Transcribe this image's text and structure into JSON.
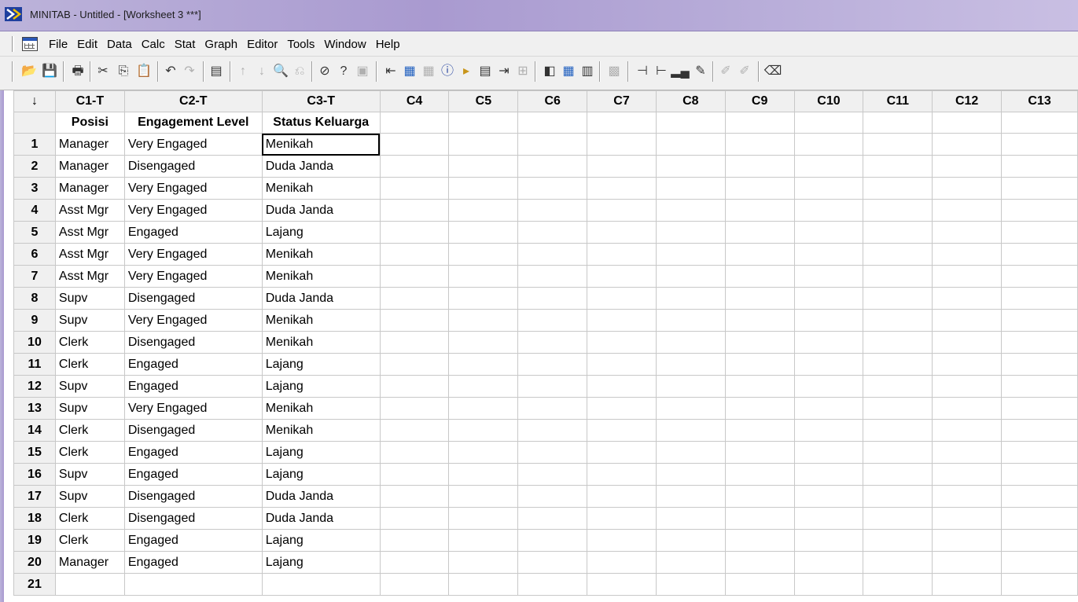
{
  "window": {
    "title": "MINITAB - Untitled - [Worksheet 3 ***]"
  },
  "menu": [
    "File",
    "Edit",
    "Data",
    "Calc",
    "Stat",
    "Graph",
    "Editor",
    "Tools",
    "Window",
    "Help"
  ],
  "toolbar": {
    "icons": [
      "open-icon",
      "save-icon",
      "print-icon",
      "cut-icon",
      "copy-icon",
      "paste-icon",
      "undo-icon",
      "redo-icon",
      "session-icon",
      "up-arrow-icon",
      "down-arrow-icon",
      "find-icon",
      "replace-icon",
      "cancel-icon",
      "help-icon",
      "project-manager-icon",
      "session-folder-icon",
      "worksheet-folder-icon",
      "graphs-folder-icon",
      "info-icon",
      "history-icon",
      "report-pad-icon",
      "related-docs-icon",
      "design-icon",
      "show-session-icon",
      "show-data-icon",
      "show-info-icon",
      "close-graphs-icon",
      "add-column-icon",
      "insert-column-icon",
      "bar-tool-icon",
      "brush-icon",
      "paint-icon",
      "eraser-icon"
    ]
  },
  "worksheet": {
    "corner": "↓",
    "columns": [
      "C1-T",
      "C2-T",
      "C3-T",
      "C4",
      "C5",
      "C6",
      "C7",
      "C8",
      "C9",
      "C10",
      "C11",
      "C12",
      "C13"
    ],
    "names": [
      "Posisi",
      "Engagement Level",
      "Status Keluarga",
      "",
      "",
      "",
      "",
      "",
      "",
      "",
      "",
      "",
      ""
    ],
    "rows": [
      [
        "Manager",
        "Very Engaged",
        "Menikah"
      ],
      [
        "Manager",
        "Disengaged",
        "Duda Janda"
      ],
      [
        "Manager",
        "Very Engaged",
        "Menikah"
      ],
      [
        "Asst Mgr",
        "Very Engaged",
        "Duda Janda"
      ],
      [
        "Asst Mgr",
        "Engaged",
        "Lajang"
      ],
      [
        "Asst Mgr",
        "Very Engaged",
        "Menikah"
      ],
      [
        "Asst Mgr",
        "Very Engaged",
        "Menikah"
      ],
      [
        "Supv",
        "Disengaged",
        "Duda Janda"
      ],
      [
        "Supv",
        "Very Engaged",
        "Menikah"
      ],
      [
        "Clerk",
        "Disengaged",
        "Menikah"
      ],
      [
        "Clerk",
        "Engaged",
        "Lajang"
      ],
      [
        "Supv",
        "Engaged",
        "Lajang"
      ],
      [
        "Supv",
        "Very Engaged",
        "Menikah"
      ],
      [
        "Clerk",
        "Disengaged",
        "Menikah"
      ],
      [
        "Clerk",
        "Engaged",
        "Lajang"
      ],
      [
        "Supv",
        "Engaged",
        "Lajang"
      ],
      [
        "Supv",
        "Disengaged",
        "Duda Janda"
      ],
      [
        "Clerk",
        "Disengaged",
        "Duda Janda"
      ],
      [
        "Clerk",
        "Engaged",
        "Lajang"
      ],
      [
        "Manager",
        "Engaged",
        "Lajang"
      ],
      [
        "",
        "",
        ""
      ]
    ],
    "row_numbers": [
      "1",
      "2",
      "3",
      "4",
      "5",
      "6",
      "7",
      "8",
      "9",
      "10",
      "11",
      "12",
      "13",
      "14",
      "15",
      "16",
      "17",
      "18",
      "19",
      "20",
      "21"
    ],
    "active_cell": "C3-T row 1"
  }
}
